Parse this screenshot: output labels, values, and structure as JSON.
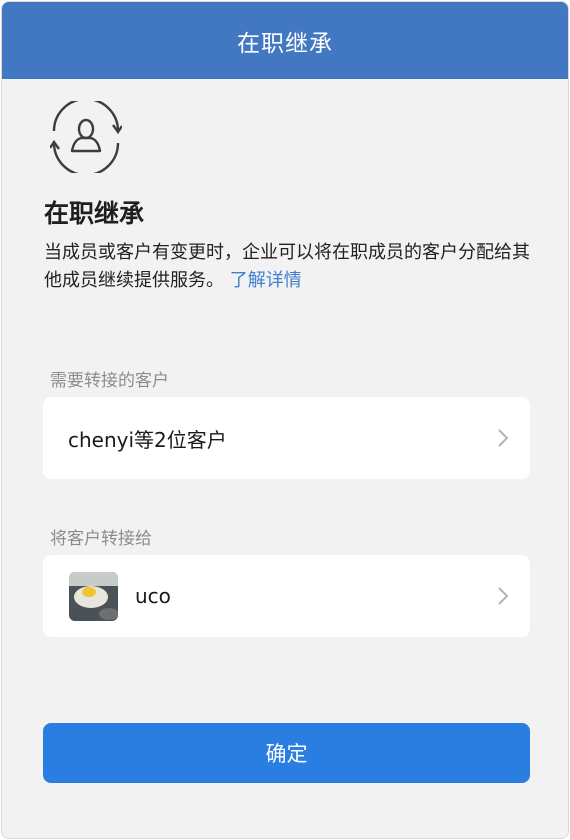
{
  "header": {
    "title": "在职继承"
  },
  "intro": {
    "icon": "user-transfer-icon",
    "title": "在职继承",
    "description": "当成员或客户有变更时，企业可以将在职成员的客户分配给其他成员继续提供服务。",
    "link_text": "了解详情"
  },
  "customers": {
    "label": "需要转接的客户",
    "value": "chenyi等2位客户"
  },
  "transfer_to": {
    "label": "将客户转接给",
    "name": "uco",
    "avatar": "fried-egg-avatar"
  },
  "confirm_button": {
    "label": "确定"
  },
  "colors": {
    "header": "#4278c1",
    "link": "#3f7fce",
    "button": "#2a7de1",
    "background": "#f2f2f2"
  }
}
